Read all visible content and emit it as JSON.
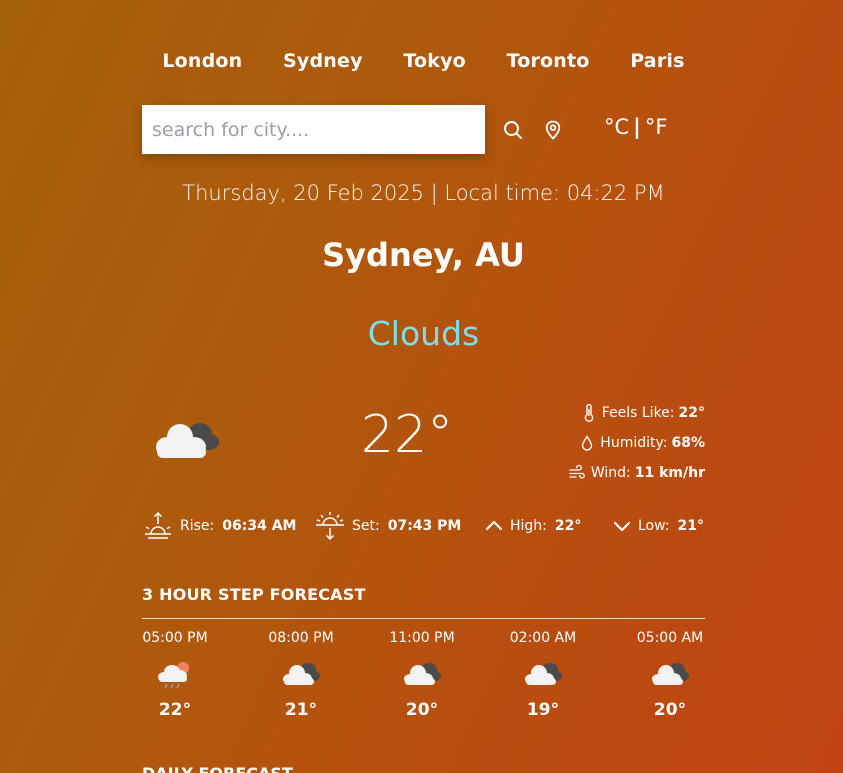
{
  "cities": [
    "London",
    "Sydney",
    "Tokyo",
    "Toronto",
    "Paris"
  ],
  "search": {
    "placeholder": "search for city...."
  },
  "icons": {
    "search": "search-icon",
    "location": "location-pin-icon",
    "current": "cloud-icon",
    "feels": "thermometer-icon",
    "humidity": "droplet-icon",
    "wind": "wind-icon",
    "rise": "sunrise-icon",
    "set": "sunset-icon",
    "high": "chevron-up-icon",
    "low": "chevron-down-icon"
  },
  "units": {
    "celsius": "°C",
    "separator": "|",
    "fahrenheit": "°F"
  },
  "datetime": "Thursday, 20 Feb 2025 | Local time: 04:22 PM",
  "location": "Sydney, AU",
  "condition": "Clouds",
  "current": {
    "temp": "22°",
    "feels_label": "Feels Like:",
    "feels_value": "22°",
    "humidity_label": "Humidity:",
    "humidity_value": "68%",
    "wind_label": "Wind:",
    "wind_value": "11 km/hr"
  },
  "sun": {
    "rise_label": "Rise:",
    "rise_value": "06:34 AM",
    "set_label": "Set:",
    "set_value": "07:43 PM",
    "high_label": "High:",
    "high_value": "22°",
    "low_label": "Low:",
    "low_value": "21°"
  },
  "forecast_title": "3 HOUR STEP FORECAST",
  "forecast": [
    {
      "time": "05:00 PM",
      "temp": "22°",
      "icon": "rain-cloud-icon"
    },
    {
      "time": "08:00 PM",
      "temp": "21°",
      "icon": "cloud-icon"
    },
    {
      "time": "11:00 PM",
      "temp": "20°",
      "icon": "cloud-icon"
    },
    {
      "time": "02:00 AM",
      "temp": "19°",
      "icon": "cloud-icon"
    },
    {
      "time": "05:00 AM",
      "temp": "20°",
      "icon": "cloud-icon"
    }
  ],
  "daily_title": "DAILY FORECAST",
  "colors": {
    "condition": "#7fdde6",
    "background_start": "#a4600b",
    "background_end": "#c04412"
  }
}
